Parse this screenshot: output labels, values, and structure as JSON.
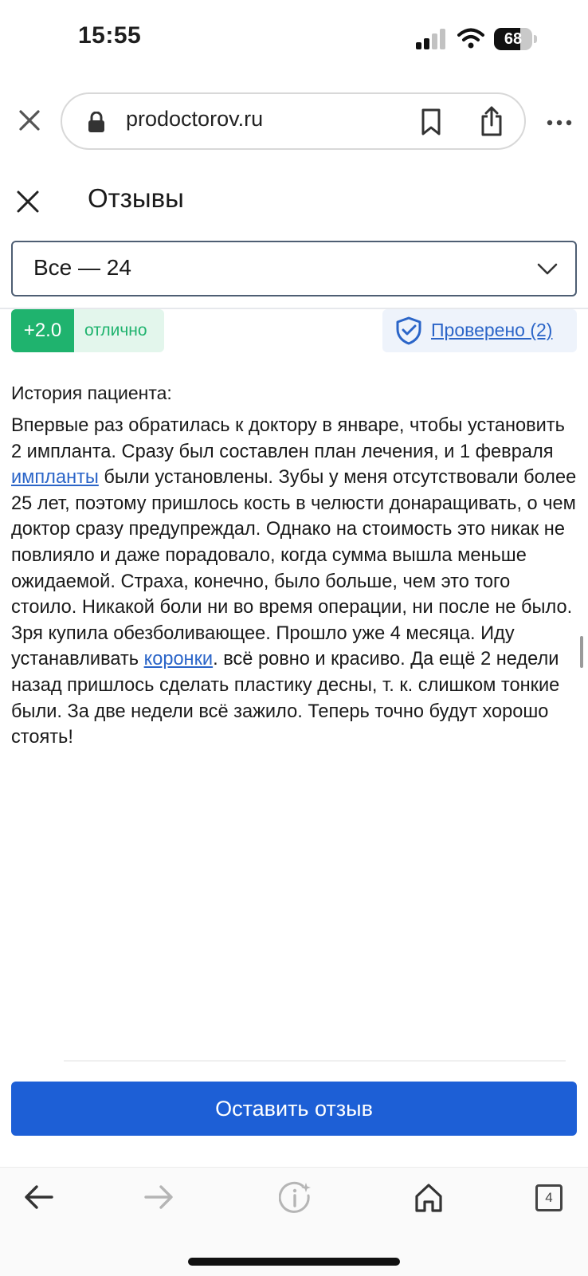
{
  "status_bar": {
    "time": "15:55",
    "battery": "68",
    "battery_fraction": 0.68
  },
  "browser": {
    "url": "prodoctorov.ru",
    "tabs_count": "4"
  },
  "reviews": {
    "title": "Отзывы",
    "filter_value": "Все — 24"
  },
  "rating": {
    "score": "+2.0",
    "label": "отлично"
  },
  "verified": {
    "label": "Проверено (2)"
  },
  "review": {
    "section_label": "История пациента:",
    "text_1": "Впервые раз обратилась к доктору в январе, чтобы установить 2 импланта. Сразу был составлен план лечения, и 1 февраля ",
    "link_1": "импланты",
    "text_2": " были установлены. Зубы у меня отсутствовали более 25 лет, поэтому пришлось кость в челюсти донаращивать, о чем доктор сразу предупреждал. Однако на стоимость это никак не повлияло и даже порадовало, когда сумма вышла меньше ожидаемой. Страха, конечно, было больше, чем это того стоило. Никакой боли ни во время операции, ни после не было. Зря купила обезболивающее. Прошло уже 4 месяца. Иду устанавливать ",
    "link_2": "коронки",
    "text_3": ". всё ровно и красиво. Да ещё 2 недели назад пришлось сделать пластику десны, т. к. слишком тонкие были. За две недели всё зажило. Теперь точно будут хорошо стоять!"
  },
  "actions": {
    "leave_review": "Оставить отзыв"
  },
  "colors": {
    "accent_blue": "#1d5fd6",
    "link_blue": "#2b65c8",
    "rating_green": "#1fb36e",
    "rating_bg": "#e3f6ec"
  },
  "icons": {
    "status": [
      "signal-icon",
      "wifi-icon",
      "battery-icon"
    ],
    "browser": [
      "close-icon",
      "lock-icon",
      "bookmark-icon",
      "share-icon",
      "more-icon"
    ],
    "nav": [
      "back-arrow-icon",
      "forward-arrow-icon",
      "info-sparkle-icon",
      "home-icon",
      "tabs-icon"
    ]
  }
}
